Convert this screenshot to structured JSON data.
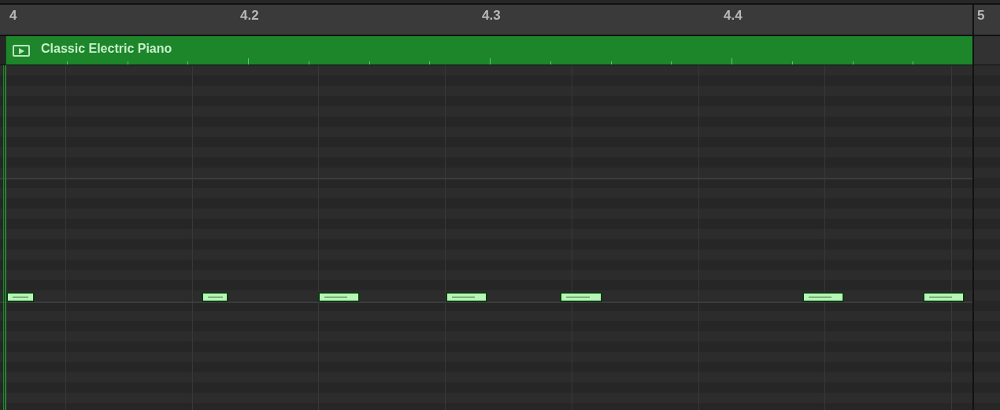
{
  "ruler": {
    "markers": [
      "4",
      "4.2",
      "4.3",
      "4.4",
      "5"
    ]
  },
  "region": {
    "name": "Classic Electric Piano"
  }
}
